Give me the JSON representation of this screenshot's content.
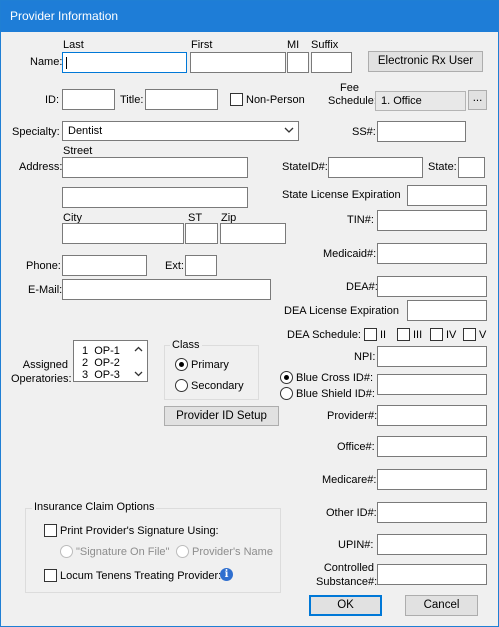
{
  "window": {
    "title": "Provider Information"
  },
  "name_section": {
    "label": "Name:",
    "col_last": "Last",
    "col_first": "First",
    "col_mi": "MI",
    "col_suffix": "Suffix",
    "last_value": "",
    "first_value": "",
    "mi_value": "",
    "suffix_value": ""
  },
  "erx_button": "Electronic Rx User",
  "id_label": "ID:",
  "id_value": "",
  "title_label": "Title:",
  "title_value": "",
  "non_person_label": "Non-Person",
  "fee_schedule": {
    "label_line1": "Fee",
    "label_line2": "Schedule:",
    "value": "1.  Office",
    "more_button": "..."
  },
  "specialty": {
    "label": "Specialty:",
    "value": "Dentist"
  },
  "ss_label": "SS#:",
  "address": {
    "label": "Address:",
    "street_label": "Street",
    "city_label": "City",
    "st_label": "ST",
    "zip_label": "Zip"
  },
  "stateid_label": "StateID#:",
  "state_label": "State:",
  "state_license_label": "State License Expiration",
  "tin_label": "TIN#:",
  "medicaid_label": "Medicaid#:",
  "phone_label": "Phone:",
  "ext_label": "Ext:",
  "email_label": "E-Mail:",
  "dea_label": "DEA#:",
  "dea_license_label": "DEA License Expiration",
  "dea_schedule": {
    "label": "DEA Schedule:",
    "options": [
      "II",
      "III",
      "IV",
      "V"
    ]
  },
  "npi_label": "NPI:",
  "operatories": {
    "label_line1": "Assigned",
    "label_line2": "Operatories:",
    "items": [
      "1  OP-1",
      "2  OP-2",
      "3  OP-3"
    ]
  },
  "class_group": {
    "title": "Class",
    "primary": "Primary",
    "secondary": "Secondary",
    "selected": "Primary"
  },
  "blue_cross_label": "Blue Cross  ID#:",
  "blue_shield_label": "Blue Shield ID#:",
  "provider_id_button": "Provider ID Setup",
  "provider_num_label": "Provider#:",
  "office_label": "Office#:",
  "medicare_label": "Medicare#:",
  "other_id_label": "Other ID#:",
  "upin_label": "UPIN#:",
  "controlled_line1": "Controlled",
  "controlled_line2": "Substance#:",
  "insurance": {
    "title": "Insurance Claim Options",
    "print_signature": "Print Provider's Signature Using:",
    "sig_on_file": "\"Signature On File\"",
    "providers_name": "Provider's Name",
    "locum_tenens": "Locum Tenens Treating Provider:"
  },
  "ok_button": "OK",
  "cancel_button": "Cancel",
  "colors": {
    "titlebar": "#1e7dd7",
    "accent": "#0078d7",
    "info_icon": "#2f6fcf"
  }
}
